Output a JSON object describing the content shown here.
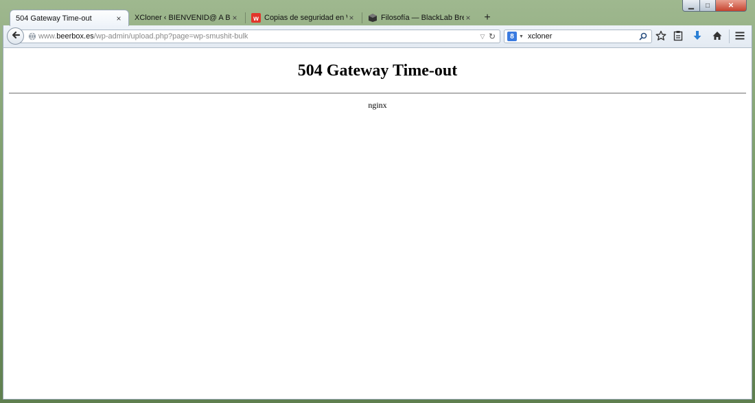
{
  "tabs": [
    {
      "label": "504 Gateway Time-out",
      "active": true
    },
    {
      "label": "XCloner ‹ BIENVENID@ A BEER...",
      "active": false
    },
    {
      "label": "Copias de seguridad en W...",
      "active": false
    },
    {
      "label": "Filosofía — BlackLab Brew...",
      "active": false
    }
  ],
  "tab_close_glyph": "×",
  "new_tab_glyph": "+",
  "url": {
    "prefix": "www.",
    "host": "beerbox.es",
    "path": "/wp-admin/upload.php?page=wp-smushit-bulk"
  },
  "search": {
    "engine_letter": "8",
    "value": "xcloner"
  },
  "page": {
    "title": "504 Gateway Time-out",
    "server": "nginx"
  },
  "colors": {
    "download_arrow": "#2a7fd4",
    "content_bg": "#ffffff",
    "search_engine_badge": "#3a7be0",
    "close_button": "#c7432e"
  },
  "icons": {
    "back": "arrow-left-icon",
    "globe": "globe-icon",
    "reload": "reload-icon",
    "search_go": "magnifier-icon",
    "bookmark": "star-icon",
    "reading": "clipboard-icon",
    "download": "download-arrow-icon",
    "home": "home-icon",
    "menu": "hamburger-menu-icon"
  }
}
